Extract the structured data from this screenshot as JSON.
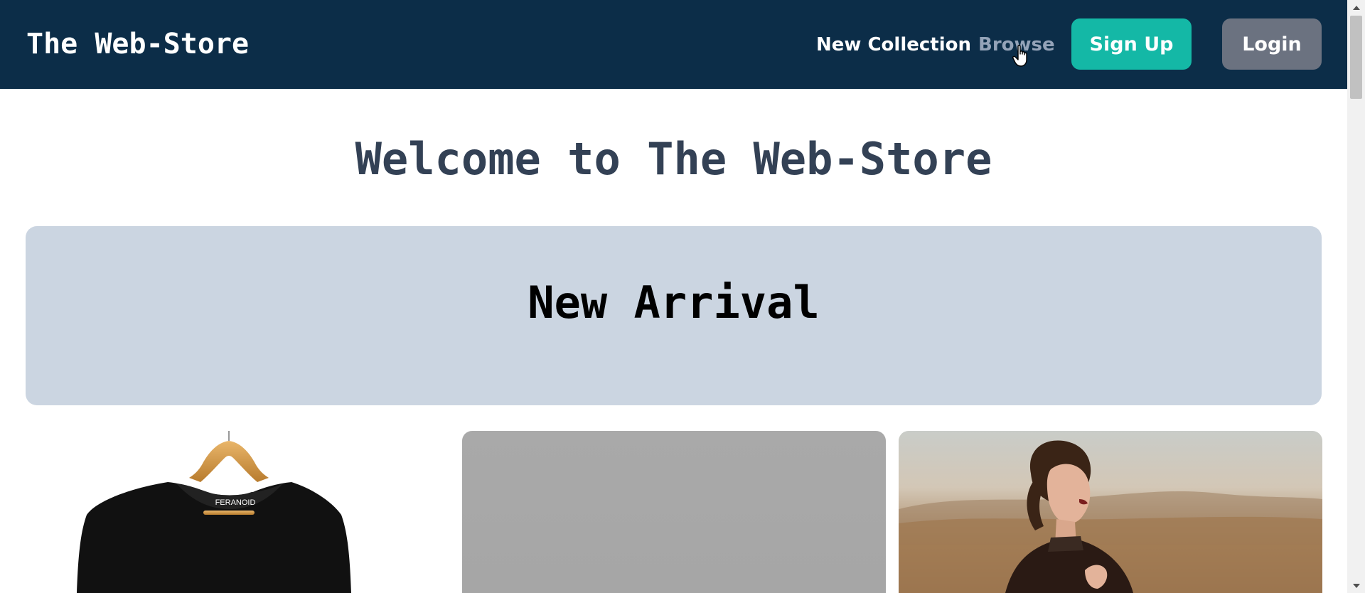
{
  "nav": {
    "brand": "The Web-Store",
    "links": [
      {
        "label": "New Collection"
      },
      {
        "label": "Browse"
      }
    ],
    "signup_label": "Sign Up",
    "login_label": "Login"
  },
  "main": {
    "heading": "Welcome to The Web-Store",
    "banner_title": "New Arrival",
    "products": [
      {
        "image": "black-tshirt-on-hanger",
        "tag_text": "FERANOID"
      },
      {
        "image": "gray-placeholder"
      },
      {
        "image": "woman-in-field"
      }
    ]
  },
  "colors": {
    "navbar": "#0c2d48",
    "signup": "#14b8a6",
    "login": "#6b7280",
    "banner": "#cbd5e1",
    "heading": "#334155",
    "browse_hover": "#94a3b8"
  }
}
